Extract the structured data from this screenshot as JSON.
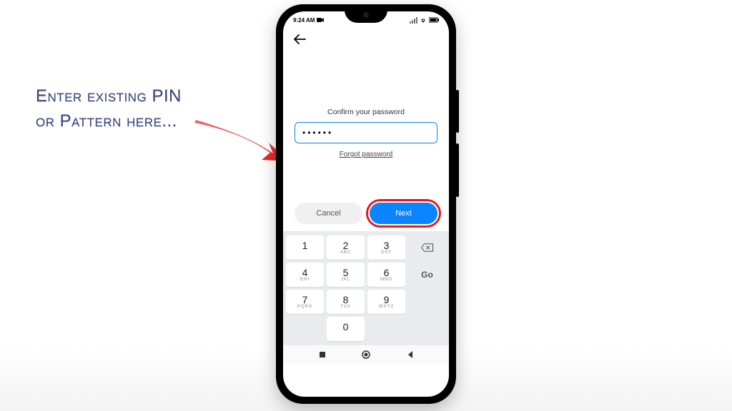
{
  "annotation": {
    "line1": "Enter existing PIN",
    "line2": "or Pattern here..."
  },
  "status": {
    "time": "9:24 AM"
  },
  "screen": {
    "prompt": "Confirm your password",
    "pin_value": "••••••",
    "forgot": "Forgot password",
    "cancel": "Cancel",
    "next": "Next"
  },
  "keypad": {
    "k1": "1",
    "k2": "2",
    "k2l": "ABC",
    "k3": "3",
    "k3l": "DEF",
    "k4": "4",
    "k4l": "GHI",
    "k5": "5",
    "k5l": "JKL",
    "k6": "6",
    "k6l": "MNO",
    "k7": "7",
    "k7l": "PQRS",
    "k8": "8",
    "k8l": "TUV",
    "k9": "9",
    "k9l": "WXYZ",
    "k0": "0",
    "go": "Go"
  }
}
